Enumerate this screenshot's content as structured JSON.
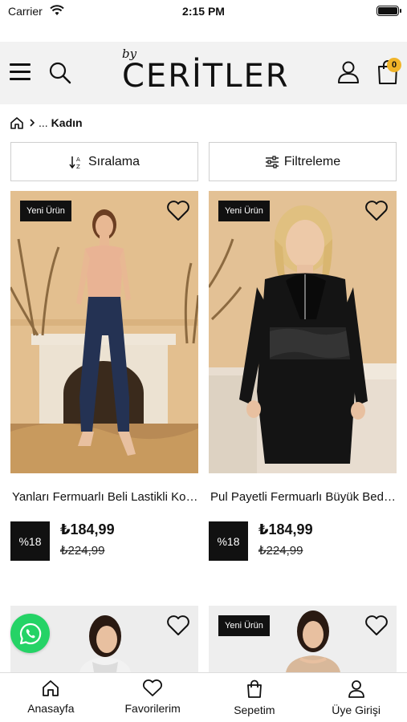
{
  "status": {
    "carrier": "Carrier",
    "time": "2:15 PM"
  },
  "header": {
    "logo_by": "by",
    "logo_name": "CERİTLER",
    "cart_count": "0"
  },
  "breadcrumb": {
    "ellipsis": "...",
    "current": "Kadın"
  },
  "toolbar": {
    "sort_label": "Sıralama",
    "filter_label": "Filtreleme"
  },
  "products": [
    {
      "tag": "Yeni Ürün",
      "name": "Yanları Fermuarlı Beli Lastikli Kot Pantolon",
      "discount": "%18",
      "price": "₺184,99",
      "old_price": "₺224,99"
    },
    {
      "tag": "Yeni Ürün",
      "name": "Pul Payetli Fermuarlı Büyük Beden Takım",
      "discount": "%18",
      "price": "₺184,99",
      "old_price": "₺224,99"
    },
    {
      "tag": "",
      "name": "",
      "discount": "",
      "price": "",
      "old_price": ""
    },
    {
      "tag": "Yeni Ürün",
      "name": "",
      "discount": "",
      "price": "",
      "old_price": ""
    }
  ],
  "tabbar": {
    "home": "Anasayfa",
    "favorites": "Favorilerim",
    "cart": "Sepetim",
    "account": "Üye Girişi"
  },
  "colors": {
    "accent_badge": "#f0b429",
    "whatsapp": "#25d366",
    "tag_bg": "#111111"
  }
}
